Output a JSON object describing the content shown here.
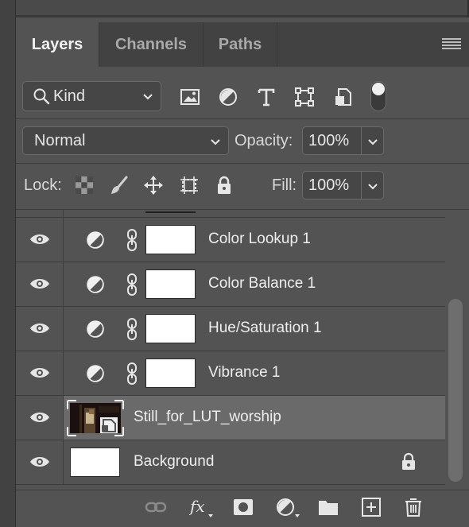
{
  "tabs": [
    {
      "label": "Layers",
      "active": true
    },
    {
      "label": "Channels",
      "active": false
    },
    {
      "label": "Paths",
      "active": false
    }
  ],
  "panel_menu_icon": "hamburger-menu-icon",
  "filter": {
    "kind_label": "Kind",
    "icons": [
      "pixel-filter-icon",
      "adjustment-filter-icon",
      "type-filter-icon",
      "shape-filter-icon",
      "smart-object-filter-icon"
    ],
    "toggle_on": true
  },
  "blend": {
    "mode": "Normal",
    "opacity_label": "Opacity:",
    "opacity_value": "100%"
  },
  "lock": {
    "label": "Lock:",
    "icons": [
      "lock-transparent-pixels-icon",
      "lock-image-pixels-icon",
      "lock-position-icon",
      "lock-artboard-icon",
      "lock-all-icon"
    ],
    "fill_label": "Fill:",
    "fill_value": "100%"
  },
  "layers": [
    {
      "name": "Color Lookup 1",
      "type": "adjustment",
      "visible": true,
      "selected": false
    },
    {
      "name": "Color Balance 1",
      "type": "adjustment",
      "visible": true,
      "selected": false
    },
    {
      "name": "Hue/Saturation 1",
      "type": "adjustment",
      "visible": true,
      "selected": false
    },
    {
      "name": "Vibrance 1",
      "type": "adjustment",
      "visible": true,
      "selected": false
    },
    {
      "name": "Still_for_LUT_worship",
      "type": "smart-object",
      "visible": true,
      "selected": true
    },
    {
      "name": "Background",
      "type": "background",
      "visible": true,
      "selected": false,
      "locked": true
    }
  ],
  "bottom_icons": [
    "link-layers-icon",
    "layer-style-fx-icon",
    "add-mask-icon",
    "new-fill-adjustment-icon",
    "new-group-icon",
    "new-layer-icon",
    "delete-layer-icon"
  ],
  "colors": {
    "panel_bg": "#535353",
    "tab_bar_bg": "#424242",
    "selected_row": "#6a6a6a"
  }
}
